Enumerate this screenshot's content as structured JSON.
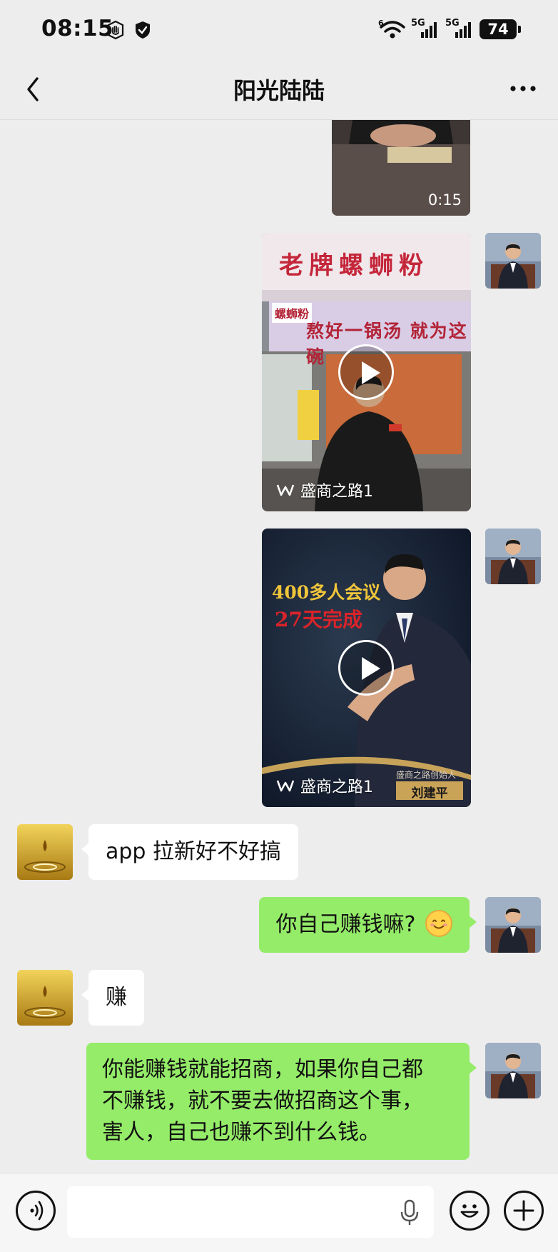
{
  "status_bar": {
    "time": "08:15",
    "signal_1": "5G",
    "signal_2": "5G",
    "wifi_label": "6",
    "battery": "74",
    "icons": [
      "hand-icon",
      "shield-icon",
      "wifi-icon",
      "signal-icon",
      "battery-icon"
    ]
  },
  "header": {
    "title": "阳光陆陆",
    "back_icon": "chevron-left-icon",
    "more_icon": "more-icon"
  },
  "messages": [
    {
      "type": "video",
      "side": "out",
      "duration": "0:15"
    },
    {
      "type": "channel_video",
      "side": "out",
      "channel": "盛商之路1",
      "sign_text": [
        "老牌螺蛳粉",
        "熬好一锅汤 就为这碗",
        "螺蛳粉"
      ]
    },
    {
      "type": "channel_video",
      "side": "out",
      "channel": "盛商之路1",
      "poster_text": [
        "400多人会议",
        "27天完成"
      ],
      "caption": "盛商之路创始人",
      "name_tag": "刘建平"
    },
    {
      "type": "text",
      "side": "in",
      "text": "app 拉新好不好搞"
    },
    {
      "type": "text",
      "side": "out",
      "text": "你自己赚钱嘛?",
      "emoji": "smile-emoji"
    },
    {
      "type": "text",
      "side": "in",
      "text": "赚"
    },
    {
      "type": "text",
      "side": "out",
      "lines": [
        "你能赚钱就能招商，如果你自己都",
        "不赚钱，就不要去做招商这个事，",
        "害人，自己也赚不到什么钱。"
      ]
    }
  ],
  "input_bar": {
    "voice_icon": "voice-icon",
    "mic_icon": "microphone-icon",
    "emoji_icon": "emoji-icon",
    "plus_icon": "plus-icon",
    "placeholder": ""
  },
  "colors": {
    "background": "#ededed",
    "out_bubble": "#95ec69",
    "in_bubble": "#ffffff"
  }
}
